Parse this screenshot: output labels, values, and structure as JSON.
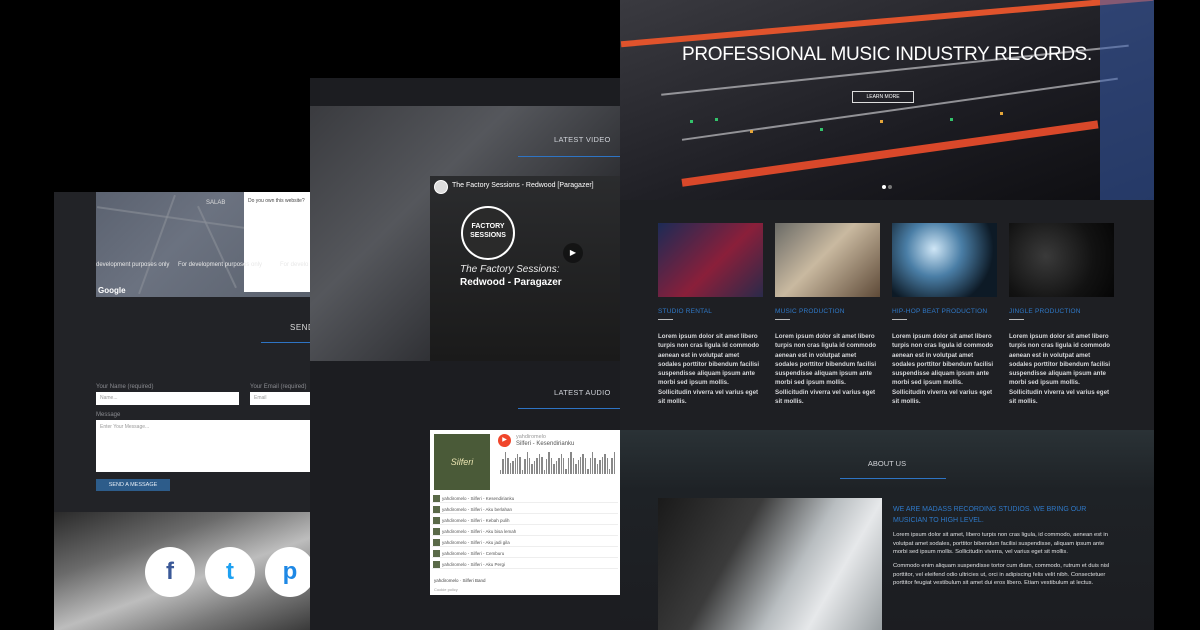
{
  "left_page": {
    "map_notice": "Do you own this website?",
    "map_dev_text": [
      "development purposes only",
      "For development purposes only",
      "For develo"
    ],
    "map_place": "SALAB",
    "map_brand": "Google",
    "form_title": "SEND",
    "name_label": "Your Name (required)",
    "name_placeholder": "Name...",
    "email_label": "Your Email (required)",
    "email_placeholder": "Email",
    "message_label": "Message",
    "message_placeholder": "Enter Your Message...",
    "send_button": "SEND A MESSAGE",
    "social": {
      "facebook": "f",
      "twitter": "t",
      "pinterest": "p"
    }
  },
  "middle_page": {
    "latest_video_title": "LATEST VIDEO",
    "video": {
      "title": "The Factory Sessions - Redwood [Paragazer]",
      "badge_line1": "FACTORY",
      "badge_line2": "SESSIONS",
      "subtitle1": "The Factory Sessions:",
      "subtitle2": "Redwood - Paragazer"
    },
    "latest_audio_title": "LATEST AUDIO",
    "audio": {
      "album_text": "Silferi",
      "user": "yahdiromelo",
      "track": "Silferi - Kesendirianku",
      "tracks": [
        "yahdiromelo - Silferi - Kesendirianku",
        "yahdiromelo - Silferi - Aku berlahan",
        "yahdiromelo - Silferi - Kebah pulih",
        "yahdiromelo - Silferi - Aku bisa lemah",
        "yahdiromelo - Silferi - Aku jadi gila",
        "yahdiromelo - Silferi - Cemburu",
        "yahdiromelo - Silferi - Aku Pergi"
      ],
      "footer_user": "yahdiromelo",
      "footer_band": "Silferi Band",
      "cookie": "Cookie policy"
    }
  },
  "right_page": {
    "hero_title": "PROFESSIONAL MUSIC INDUSTRY RECORDS.",
    "hero_button": "LEARN MORE",
    "services": [
      {
        "title": "STUDIO RENTAL",
        "text": "Lorem ipsum dolor sit amet libero turpis non cras ligula id commodo aenean est in volutpat amet sodales porttitor bibendum facilisi suspendisse aliquam ipsum ante morbi sed ipsum mollis. Sollicitudin viverra vel varius eget sit mollis."
      },
      {
        "title": "MUSIC PRODUCTION",
        "text": "Lorem ipsum dolor sit amet libero turpis non cras ligula id commodo aenean est in volutpat amet sodales porttitor bibendum facilisi suspendisse aliquam ipsum ante morbi sed ipsum mollis. Sollicitudin viverra vel varius eget sit mollis."
      },
      {
        "title": "HIP-HOP BEAT PRODUCTION",
        "text": "Lorem ipsum dolor sit amet libero turpis non cras ligula id commodo aenean est in volutpat amet sodales porttitor bibendum facilisi suspendisse aliquam ipsum ante morbi sed ipsum mollis. Sollicitudin viverra vel varius eget sit mollis."
      },
      {
        "title": "JINGLE PRODUCTION",
        "text": "Lorem ipsum dolor sit amet libero turpis non cras ligula id commodo aenean est in volutpat amet sodales porttitor bibendum facilisi suspendisse aliquam ipsum ante morbi sed ipsum mollis. Sollicitudin viverra vel varius eget sit mollis."
      }
    ],
    "about_title": "ABOUT US",
    "about_heading": "WE ARE MADASS RECORDING STUDIOS. WE BRING OUR MUSICIAN TO HIGH LEVEL.",
    "about_p1": "Lorem ipsum dolor sit amet, libero turpis non cras ligula, id commodo, aenean est in volutpat amet sodales, porttitor bibendum facilisi suspendisse, aliquam ipsum ante morbi sed ipsum mollis. Sollicitudin viverra, vel varius eget sit mollis.",
    "about_p2": "Commodo enim aliquam suspendisse tortor cum diam, commodo, rutrum et duis nisl porttitor, vel eleifend odio ultricies ut, orci in adipiscing felis velit nibh. Consectetuer porttitor feugiat vestibulum sit amet dui eros libero. Etiam vestibulum at lectus."
  },
  "colors": {
    "accent": "#2e74c4",
    "background": "#000000",
    "panel": "#1e1f23"
  }
}
